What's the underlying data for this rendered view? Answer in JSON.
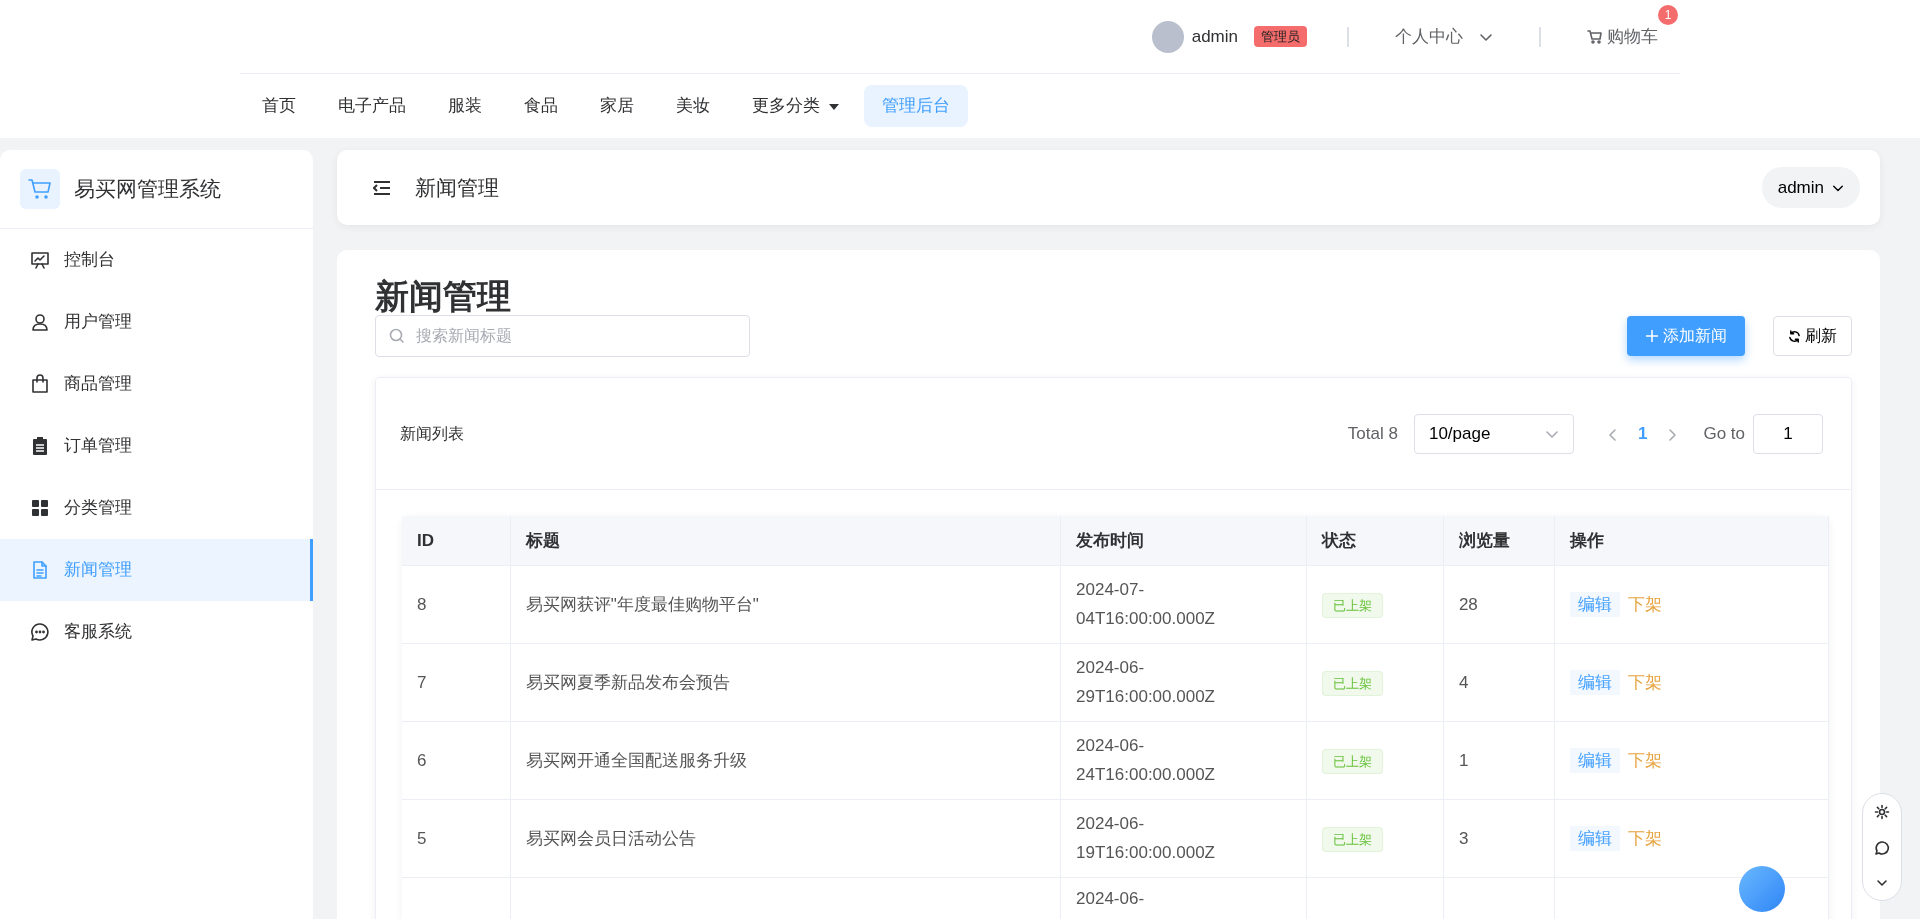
{
  "top_bar": {
    "user": {
      "name": "admin",
      "role_badge": "管理员"
    },
    "personal_center": "个人中心",
    "cart": {
      "label": "购物车",
      "count": "1"
    }
  },
  "top_menu": [
    {
      "label": "首页",
      "kind": "link",
      "selected": false
    },
    {
      "label": "电子产品",
      "kind": "link",
      "selected": false
    },
    {
      "label": "服装",
      "kind": "link",
      "selected": false
    },
    {
      "label": "食品",
      "kind": "link",
      "selected": false
    },
    {
      "label": "家居",
      "kind": "link",
      "selected": false
    },
    {
      "label": "美妆",
      "kind": "link",
      "selected": false
    },
    {
      "label": "更多分类",
      "kind": "dropdown",
      "selected": false
    },
    {
      "label": "管理后台",
      "kind": "link",
      "selected": true
    }
  ],
  "sidebar": {
    "title": "易买网管理系统",
    "items": [
      {
        "label": "控制台",
        "selected": false
      },
      {
        "label": "用户管理",
        "selected": false
      },
      {
        "label": "商品管理",
        "selected": false
      },
      {
        "label": "订单管理",
        "selected": false
      },
      {
        "label": "分类管理",
        "selected": false
      },
      {
        "label": "新闻管理",
        "selected": true
      },
      {
        "label": "客服系统",
        "selected": false
      }
    ]
  },
  "header": {
    "title": "新闻管理",
    "user_menu": "admin"
  },
  "page": {
    "title": "新闻管理",
    "search": {
      "placeholder": "搜索新闻标题"
    },
    "buttons": [
      {
        "label": "添加新闻",
        "kind": "add"
      },
      {
        "label": "刷新",
        "kind": "refresh"
      }
    ]
  },
  "list": {
    "title": "新闻列表",
    "total": "Total 8",
    "page_size": "10/page",
    "current_page": "1",
    "goto_label": "Go to",
    "goto_value": "1"
  },
  "table": {
    "columns": [
      "ID",
      "标题",
      "发布时间",
      "状态",
      "浏览量",
      "操作"
    ],
    "rows": [
      {
        "id": "8",
        "title": "易买网获评\"年度最佳购物平台\"",
        "published": "2024-07-04T16:00:00.000Z",
        "status": "已上架",
        "views": "28",
        "actions": [
          "编辑",
          "下架"
        ]
      },
      {
        "id": "7",
        "title": "易买网夏季新品发布会预告",
        "published": "2024-06-29T16:00:00.000Z",
        "status": "已上架",
        "views": "4",
        "actions": [
          "编辑",
          "下架"
        ]
      },
      {
        "id": "6",
        "title": "易买网开通全国配送服务升级",
        "published": "2024-06-24T16:00:00.000Z",
        "status": "已上架",
        "views": "1",
        "actions": [
          "编辑",
          "下架"
        ]
      },
      {
        "id": "5",
        "title": "易买网会员日活动公告",
        "published": "2024-06-19T16:00:00.000Z",
        "status": "已上架",
        "views": "3",
        "actions": [
          "编辑",
          "下架"
        ]
      },
      {
        "published": "2024-06-"
      }
    ]
  }
}
